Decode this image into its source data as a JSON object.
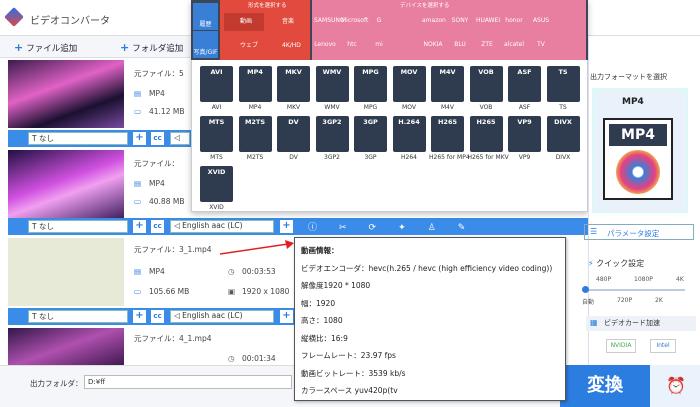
{
  "app": {
    "title": "ビデオコンバータ"
  },
  "toolbar": {
    "add_file": "ファイル追加",
    "add_folder": "フォルダ追加"
  },
  "files": [
    {
      "label": "元ファイル：5",
      "format": "MP4",
      "size": "41.12 MB"
    },
    {
      "label": "元ファイル：",
      "format": "MP4",
      "size": "40.88 MB"
    },
    {
      "label": "元ファイル：3_1.mp4",
      "format": "MP4",
      "size": "105.66 MB",
      "duration": "00:03:53",
      "resolution": "1920 x 1080"
    },
    {
      "label": "元ファイル：4_1.mp4",
      "format": "MP4",
      "duration": "00:01:34"
    }
  ],
  "controls": {
    "subtitle": "なし",
    "audio": "English aac (LC)"
  },
  "panel": {
    "cat_format": "形式を選択する",
    "cat_device": "デバイスを選択する",
    "tab_history": "履歴",
    "tab_video": "動画",
    "tab_audio": "音楽",
    "tab_web": "ウェブ",
    "tab_4k": "4K/HD",
    "tab_photo": "写真/GIF",
    "formats": [
      {
        "name": "AVI",
        "label": "AVI",
        "color": "#2f3b4e"
      },
      {
        "name": "MP4",
        "label": "MP4",
        "color": "#2f3b4e"
      },
      {
        "name": "MKV",
        "label": "MKV",
        "color": "#2f3b4e"
      },
      {
        "name": "WMV",
        "label": "WMV",
        "color": "#2f3b4e"
      },
      {
        "name": "MPG",
        "label": "MPG",
        "color": "#2f3b4e"
      },
      {
        "name": "MOV",
        "label": "MOV",
        "color": "#2f3b4e"
      },
      {
        "name": "M4V",
        "label": "M4V",
        "color": "#2f3b4e"
      },
      {
        "name": "VOB",
        "label": "VOB",
        "color": "#2f3b4e"
      },
      {
        "name": "ASF",
        "label": "ASF",
        "color": "#2f3b4e"
      },
      {
        "name": "TS",
        "label": "TS",
        "color": "#2f3b4e"
      },
      {
        "name": "MTS",
        "label": "MTS",
        "color": "#2f3b4e"
      },
      {
        "name": "M2TS",
        "label": "M2TS",
        "color": "#2f3b4e"
      },
      {
        "name": "DV",
        "label": "DV",
        "color": "#2f3b4e"
      },
      {
        "name": "3GP2",
        "label": "3GP2",
        "color": "#2f3b4e"
      },
      {
        "name": "3GP",
        "label": "3GP",
        "color": "#2f3b4e"
      },
      {
        "name": "H.264",
        "label": "H264",
        "color": "#2f3b4e"
      },
      {
        "name": "H265",
        "label": "H265 for MP4",
        "color": "#2f3b4e"
      },
      {
        "name": "H265",
        "label": "H265 for MKV",
        "color": "#2f3b4e"
      },
      {
        "name": "VP9",
        "label": "VP9",
        "color": "#2f3b4e"
      },
      {
        "name": "DIVX",
        "label": "DIVX",
        "color": "#2f3b4e"
      },
      {
        "name": "XVID",
        "label": "XVID",
        "color": "#2f3b4e"
      }
    ],
    "devices": [
      "SAMSUNG",
      "Microsoft",
      "G",
      "",
      "amazon",
      "SONY",
      "HUAWEI",
      "honor",
      "ASUS",
      "",
      "Lenovo",
      "htc",
      "mi",
      "",
      "NOKIA",
      "BLU",
      "ZTE",
      "alcatel",
      "TV"
    ]
  },
  "right": {
    "select_label": "出力フォーマットを選択",
    "selected": "MP4",
    "param_btn": "パラメータ設定",
    "quick": "クイック設定",
    "q480": "480P",
    "q1080": "1080P",
    "q4k": "4K",
    "auto": "自動",
    "q720": "720P",
    "q2k": "2K",
    "gpu": "ビデオカード加速",
    "nvidia": "NVIDIA",
    "intel": "Intel"
  },
  "tooltip": {
    "title": "動画情報：",
    "encoder_label": "ビデオエンコーダ：",
    "encoder_value": "hevc(h.265 / hevc (high efficiency video coding))",
    "res_label": "解像度",
    "res_value": "1920 * 1080",
    "width_label": "幅：",
    "width_value": "1920",
    "height_label": "高さ：",
    "height_value": "1080",
    "aspect_label": "縦横比：",
    "aspect_value": "16:9",
    "fps_label": "フレームレート：",
    "fps_value": "23.97 fps",
    "bitrate_label": "動画ビットレート：",
    "bitrate_value": "3539 kb/s",
    "color_label": "カラースペース",
    "color_value": "yuv420p(tv"
  },
  "bottom": {
    "folder_label": "出力フォルダ：",
    "folder_value": "D:¥ff",
    "convert": "変換"
  }
}
